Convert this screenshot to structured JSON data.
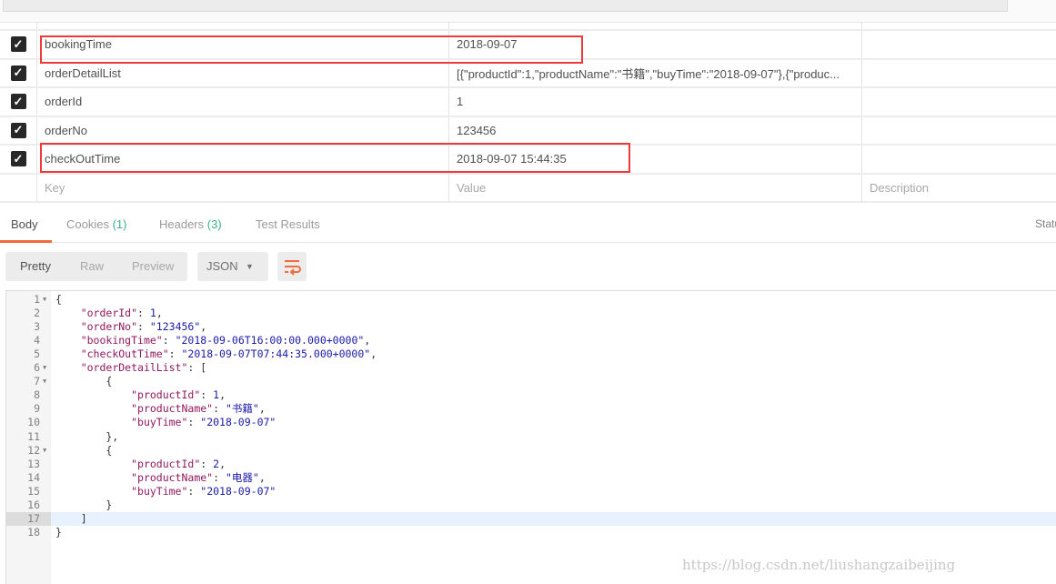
{
  "params": {
    "rows": [
      {
        "key": "bookingTime",
        "value": "2018-09-07",
        "checked": true
      },
      {
        "key": "orderDetailList",
        "value": "[{\"productId\":1,\"productName\":\"书籍\",\"buyTime\":\"2018-09-07\"},{\"produc...",
        "checked": true
      },
      {
        "key": "orderId",
        "value": "1",
        "checked": true
      },
      {
        "key": "orderNo",
        "value": "123456",
        "checked": true
      },
      {
        "key": "checkOutTime",
        "value": "2018-09-07 15:44:35",
        "checked": true
      }
    ],
    "placeholder": {
      "key": "Key",
      "value": "Value",
      "description": "Description"
    }
  },
  "response": {
    "tabs": [
      {
        "label": "Body",
        "count": ""
      },
      {
        "label": "Cookies",
        "count": "(1)"
      },
      {
        "label": "Headers",
        "count": "(3)"
      },
      {
        "label": "Test Results",
        "count": ""
      }
    ],
    "status_label": "Statu",
    "view_modes": [
      "Pretty",
      "Raw",
      "Preview"
    ],
    "format": "JSON",
    "accent": "#f26b3a",
    "code_lines": [
      [
        [
          "p",
          "{"
        ]
      ],
      [
        [
          "p",
          "    "
        ],
        [
          "k",
          "\"orderId\""
        ],
        [
          "p",
          ": "
        ],
        [
          "n",
          "1"
        ],
        [
          "p",
          ","
        ]
      ],
      [
        [
          "p",
          "    "
        ],
        [
          "k",
          "\"orderNo\""
        ],
        [
          "p",
          ": "
        ],
        [
          "s",
          "\"123456\""
        ],
        [
          "p",
          ","
        ]
      ],
      [
        [
          "p",
          "    "
        ],
        [
          "k",
          "\"bookingTime\""
        ],
        [
          "p",
          ": "
        ],
        [
          "s",
          "\"2018-09-06T16:00:00.000+0000\""
        ],
        [
          "p",
          ","
        ]
      ],
      [
        [
          "p",
          "    "
        ],
        [
          "k",
          "\"checkOutTime\""
        ],
        [
          "p",
          ": "
        ],
        [
          "s",
          "\"2018-09-07T07:44:35.000+0000\""
        ],
        [
          "p",
          ","
        ]
      ],
      [
        [
          "p",
          "    "
        ],
        [
          "k",
          "\"orderDetailList\""
        ],
        [
          "p",
          ": ["
        ]
      ],
      [
        [
          "p",
          "        {"
        ]
      ],
      [
        [
          "p",
          "            "
        ],
        [
          "k",
          "\"productId\""
        ],
        [
          "p",
          ": "
        ],
        [
          "n",
          "1"
        ],
        [
          "p",
          ","
        ]
      ],
      [
        [
          "p",
          "            "
        ],
        [
          "k",
          "\"productName\""
        ],
        [
          "p",
          ": "
        ],
        [
          "s",
          "\"书籍\""
        ],
        [
          "p",
          ","
        ]
      ],
      [
        [
          "p",
          "            "
        ],
        [
          "k",
          "\"buyTime\""
        ],
        [
          "p",
          ": "
        ],
        [
          "s",
          "\"2018-09-07\""
        ]
      ],
      [
        [
          "p",
          "        },"
        ]
      ],
      [
        [
          "p",
          "        {"
        ]
      ],
      [
        [
          "p",
          "            "
        ],
        [
          "k",
          "\"productId\""
        ],
        [
          "p",
          ": "
        ],
        [
          "n",
          "2"
        ],
        [
          "p",
          ","
        ]
      ],
      [
        [
          "p",
          "            "
        ],
        [
          "k",
          "\"productName\""
        ],
        [
          "p",
          ": "
        ],
        [
          "s",
          "\"电器\""
        ],
        [
          "p",
          ","
        ]
      ],
      [
        [
          "p",
          "            "
        ],
        [
          "k",
          "\"buyTime\""
        ],
        [
          "p",
          ": "
        ],
        [
          "s",
          "\"2018-09-07\""
        ]
      ],
      [
        [
          "p",
          "        }"
        ]
      ],
      [
        [
          "p",
          "    ]"
        ]
      ],
      [
        [
          "p",
          "}"
        ]
      ]
    ],
    "fold_lines": [
      1,
      6,
      7,
      12
    ],
    "current_line": 17
  },
  "watermark": "https://blog.csdn.net/liushangzaibeijing"
}
